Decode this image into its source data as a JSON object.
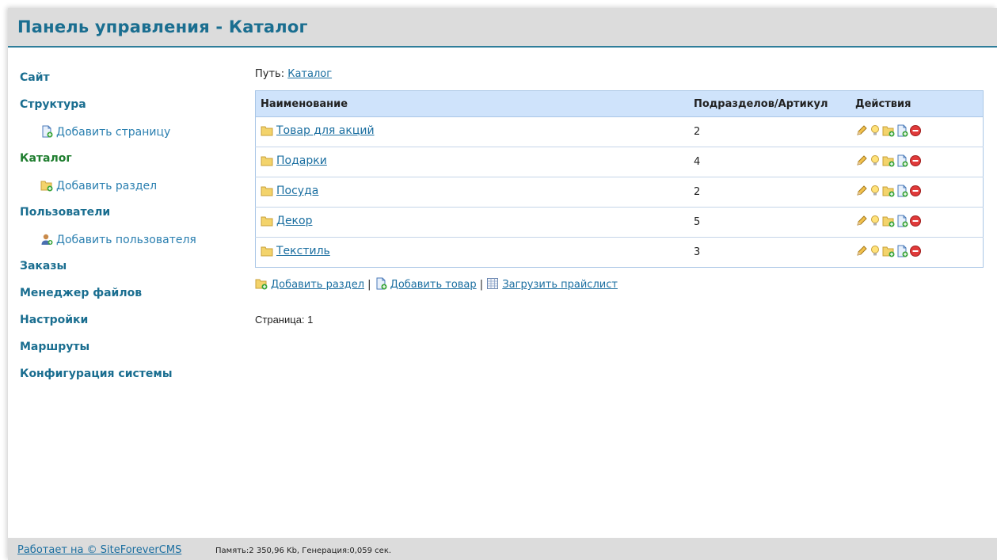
{
  "header": {
    "title": "Панель управления - Каталог"
  },
  "sidebar": {
    "items": [
      {
        "label": "Сайт"
      },
      {
        "label": "Структура"
      },
      {
        "label": "Добавить страницу"
      },
      {
        "label": "Каталог"
      },
      {
        "label": "Добавить раздел"
      },
      {
        "label": "Пользователи"
      },
      {
        "label": "Добавить пользователя"
      },
      {
        "label": "Заказы"
      },
      {
        "label": "Менеджер файлов"
      },
      {
        "label": "Настройки"
      },
      {
        "label": "Маршруты"
      },
      {
        "label": "Конфигурация системы"
      }
    ]
  },
  "main": {
    "path_label": "Путь:",
    "path_link": "Каталог",
    "table": {
      "columns": [
        "Наименование",
        "Подразделов/Артикул",
        "Действия"
      ],
      "rows": [
        {
          "name": "Товар для акций",
          "count": "2"
        },
        {
          "name": "Подарки",
          "count": "4"
        },
        {
          "name": "Посуда",
          "count": "2"
        },
        {
          "name": "Декор",
          "count": "5"
        },
        {
          "name": "Текстиль",
          "count": "3"
        }
      ]
    },
    "links": {
      "add_section": "Добавить раздел",
      "add_product": "Добавить товар",
      "upload_price": "Загрузить прайслист",
      "separator": "|"
    },
    "page_info": "Страница: 1"
  },
  "footer": {
    "powered": "Работает на © SiteForeverCMS",
    "stats": "Память:2 350,96 Kb, Генерация:0,059 сек."
  }
}
